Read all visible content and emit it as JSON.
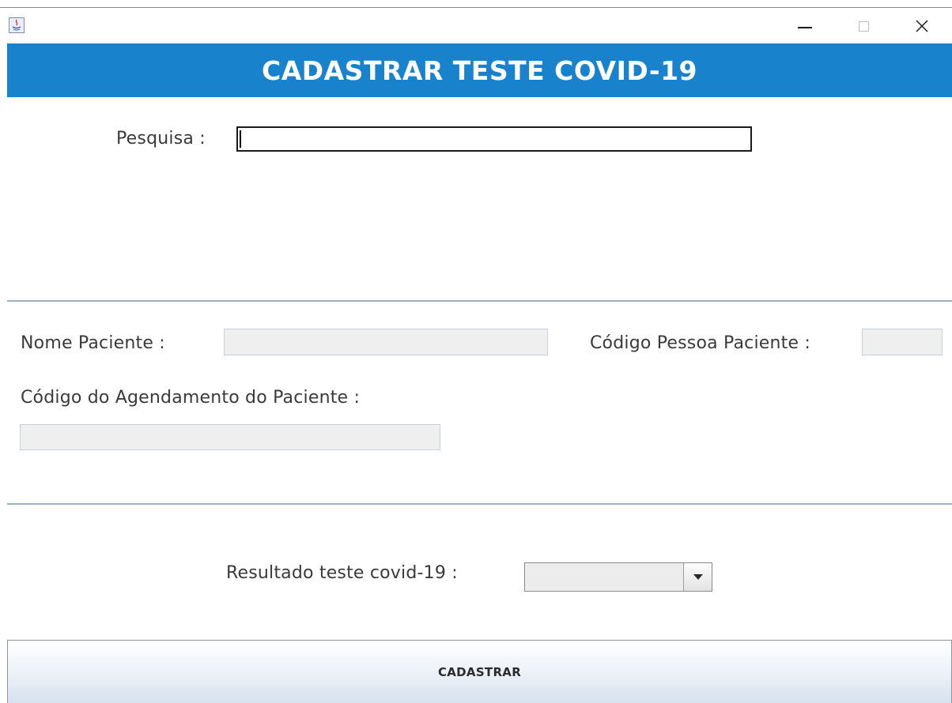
{
  "window": {
    "minimize_icon": "minimize-icon",
    "maximize_icon": "maximize-icon",
    "close_icon": "close-icon",
    "app_icon": "java-icon"
  },
  "header": {
    "title": "CADASTRAR TESTE COVID-19",
    "background_color": "#1982cc"
  },
  "search": {
    "label": "Pesquisa :",
    "value": ""
  },
  "patient": {
    "name_label": "Nome Paciente :",
    "name_value": "",
    "person_code_label": "Código Pessoa Paciente :",
    "person_code_value": "",
    "appointment_code_label": "Código do Agendamento do Paciente :",
    "appointment_code_value": ""
  },
  "result": {
    "label": "Resultado teste covid-19 :",
    "selected": ""
  },
  "actions": {
    "submit_label": "CADASTRAR"
  }
}
